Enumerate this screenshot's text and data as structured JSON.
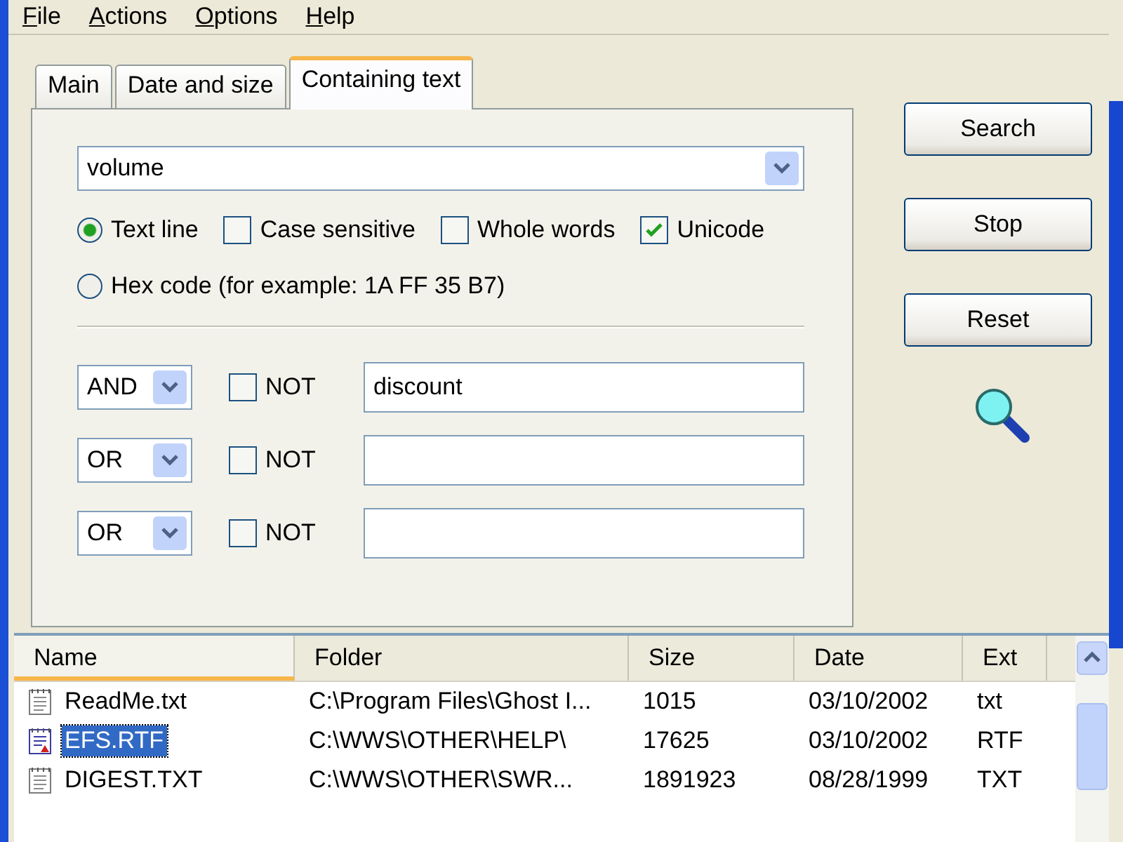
{
  "menu": [
    {
      "label": "File"
    },
    {
      "label": "Actions"
    },
    {
      "label": "Options"
    },
    {
      "label": "Help"
    }
  ],
  "tabs": [
    {
      "label": "Main",
      "selected": false
    },
    {
      "label": "Date and size",
      "selected": false
    },
    {
      "label": "Containing text",
      "selected": true
    }
  ],
  "search_text": {
    "value": "volume"
  },
  "options": [
    {
      "kind": "radio",
      "label": "Text line",
      "selected": true
    },
    {
      "kind": "checkbox",
      "label": "Case sensitive",
      "checked": false
    },
    {
      "kind": "checkbox",
      "label": "Whole words",
      "checked": false
    },
    {
      "kind": "checkbox",
      "label": "Unicode",
      "checked": true
    }
  ],
  "hex_option": {
    "label": "Hex code (for example: 1A FF 35 B7)",
    "selected": false
  },
  "conditions": [
    {
      "operator": "AND",
      "not_label": "NOT",
      "not": false,
      "value": "discount"
    },
    {
      "operator": "OR",
      "not_label": "NOT",
      "not": false
    },
    {
      "operator": "OR",
      "not_label": "NOT",
      "not": false
    }
  ],
  "buttons": [
    "Search",
    "Stop",
    "Reset"
  ],
  "results": {
    "columns": [
      {
        "label": "Name",
        "sorted": true
      },
      {
        "label": "Folder",
        "sorted": false
      },
      {
        "label": "Size",
        "sorted": false
      },
      {
        "label": "Date",
        "sorted": false
      },
      {
        "label": "Ext",
        "sorted": false
      }
    ],
    "rows": [
      {
        "kind": "text",
        "selected": false,
        "cells": [
          "ReadMe.txt",
          "C:\\Program Files\\Ghost I...",
          "1015",
          "03/10/2002",
          "txt"
        ]
      },
      {
        "kind": "rtf",
        "selected": true,
        "cells": [
          "EFS.RTF",
          "C:\\WWS\\OTHER\\HELP\\",
          "17625",
          "03/10/2002",
          "RTF"
        ]
      },
      {
        "kind": "text",
        "selected": false,
        "cells": [
          "DIGEST.TXT",
          "C:\\WWS\\OTHER\\SWR...",
          "1891923",
          "08/28/1999",
          "TXT"
        ]
      }
    ]
  }
}
